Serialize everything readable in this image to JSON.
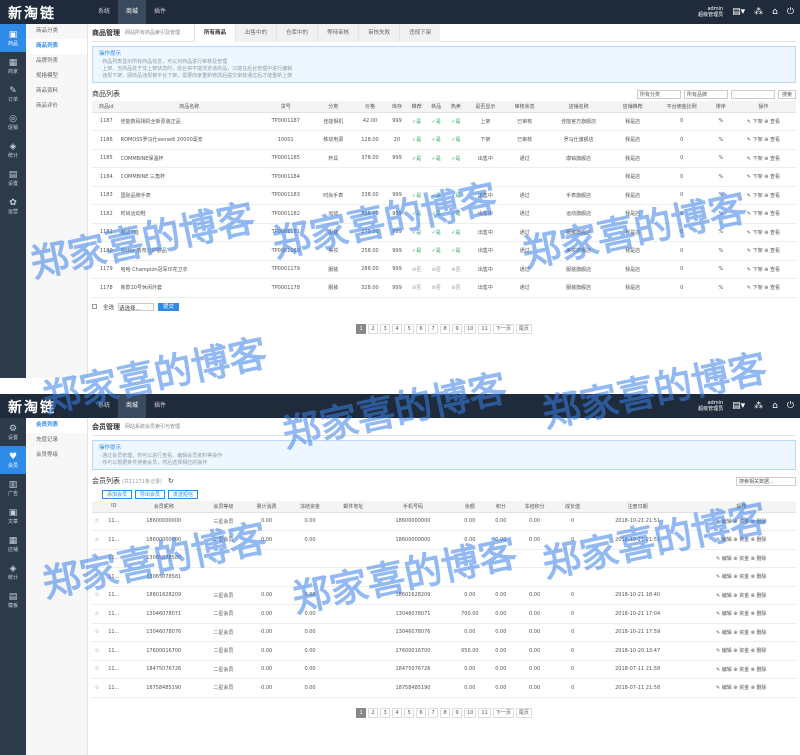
{
  "panel1": {
    "logo": "新淘链",
    "nav": [
      "系统",
      "商城",
      "插件"
    ],
    "nav_active": 1,
    "admin_name": "admin",
    "admin_role": "超级管理员",
    "sidebar": [
      {
        "icon": "▣",
        "label": "商品"
      },
      {
        "icon": "▦",
        "label": "商家"
      },
      {
        "icon": "✎",
        "label": "订单"
      },
      {
        "icon": "◎",
        "label": "促销"
      },
      {
        "icon": "◈",
        "label": "统计"
      },
      {
        "icon": "▤",
        "label": "设置"
      },
      {
        "icon": "✿",
        "label": "运营"
      }
    ],
    "sidebar_active": 0,
    "subnav": [
      "商品分类",
      "商品列表",
      "品牌列表",
      "规格模型",
      "商品资料",
      "商品评价"
    ],
    "subnav_active": 1,
    "title": "商品管理",
    "subtitle": "网站所有商品索引及管理",
    "tabs": [
      "所有商品",
      "出售中的",
      "仓库中的",
      "等待审核",
      "审核失败",
      "违规下架"
    ],
    "tab_active": 0,
    "tip_head": "操作提示",
    "tips": [
      "· 商品列表显示所有商品信息，可以对商品进行审核及管理",
      "· 上架，当商品处于非上架状态时，前台将不能浏览该商品，只能在后台管理中进行编辑",
      "· 违规下架，即商品违规被平台下架，需要商家重新修改后提交审核通过后才能重新上架"
    ],
    "list_title": "商品列表",
    "filter1": "所有分类",
    "filter2": "所有品牌",
    "search_btn": "搜索",
    "columns": [
      "商品id",
      "商品名称",
      "货号",
      "分类",
      "价格",
      "库存",
      "推荐",
      "新品",
      "热卖",
      "是否显示",
      "审核状态",
      "店铺名称",
      "店铺推荐",
      "平台佣金比例",
      "排序",
      "操作"
    ],
    "rows": [
      [
        "1187",
        "佳能数码相机全新原装正品",
        "TP0001187",
        "佳能相机",
        "42.00",
        "999",
        "✓是",
        "✓是",
        "✓是",
        "上架",
        "已审核",
        "佳能官方旗舰店",
        "我是店",
        "0",
        "%",
        "✎ 下架 ⊕ 查看"
      ],
      [
        "1186",
        "ROMOSS罗马仕sense6 20000毫安",
        "10001",
        "移动电源",
        "128.00",
        "20",
        "✓是",
        "✓是",
        "✓是",
        "下架",
        "已审核",
        "罗马仕旗舰店",
        "我是店",
        "0",
        "%",
        "✎ 下架 ⊕ 查看"
      ],
      [
        "1185",
        "COMMBINE保温杯",
        "TP0001185",
        "杯具",
        "378.00",
        "999",
        "✓是",
        "✓是",
        "✓是",
        "出售中",
        "通过",
        "康铂旗舰店",
        "我是店",
        "0",
        "%",
        "✎ 下架 ⊕ 查看"
      ],
      [
        "1184",
        "COMMBINE 三角杯",
        "TP0001184",
        "",
        "",
        "",
        "",
        "",
        "",
        "",
        "",
        "",
        "我是店",
        "0",
        "%",
        "✎ 下架 ⊕ 查看"
      ],
      [
        "1183",
        "国际品牌手表",
        "TP0001183",
        "时尚手表",
        "338.00",
        "999",
        "✓是",
        "✓是",
        "✓是",
        "出售中",
        "通过",
        "手表旗舰店",
        "我是店",
        "0",
        "%",
        "✎ 下架 ⊕ 查看"
      ],
      [
        "1182",
        "时尚运动鞋",
        "TP0001182",
        "运动",
        "338.00",
        "999",
        "✓是",
        "✓是",
        "✓是",
        "出售中",
        "通过",
        "运动旗舰店",
        "我是店",
        "0",
        "%",
        "✎ 下架 ⊕ 查看"
      ],
      [
        "1181",
        "潮流T恤",
        "TP0001181",
        "服装",
        "279.00",
        "999",
        "✓是",
        "✓是",
        "✓是",
        "出售中",
        "通过",
        "服装旗舰店",
        "我是店",
        "0",
        "%",
        "✎ 下架 ⊕ 查看"
      ],
      [
        "1180",
        "Sisley 香奈儿护肤品",
        "TP0001180",
        "美妆",
        "258.00",
        "999",
        "✓是",
        "✓是",
        "✓是",
        "出售中",
        "通过",
        "美妆旗舰店",
        "我是店",
        "0",
        "%",
        "✎ 下架 ⊕ 查看"
      ],
      [
        "1179",
        "哈哈 Champion冠军印花卫衣",
        "TP0001179",
        "服装",
        "288.00",
        "999",
        "⊘否",
        "⊘否",
        "⊘否",
        "出售中",
        "通过",
        "服装旗舰店",
        "我是店",
        "0",
        "%",
        "✎ 下架 ⊕ 查看"
      ],
      [
        "1178",
        "新款10号休闲外套",
        "TP0001178",
        "服装",
        "328.00",
        "999",
        "⊘否",
        "⊘否",
        "⊘否",
        "出售中",
        "通过",
        "服装旗舰店",
        "我是店",
        "0",
        "%",
        "✎ 下架 ⊕ 查看"
      ]
    ],
    "bulk_label": "全选",
    "bulk_select": "请选择...",
    "bulk_btn": "提交",
    "pages": [
      "1",
      "2",
      "3",
      "4",
      "5",
      "6",
      "7",
      "8",
      "9",
      "10",
      "11",
      "下一页",
      "尾页"
    ]
  },
  "panel2": {
    "logo": "新淘链",
    "nav": [
      "系统",
      "商城",
      "插件"
    ],
    "nav_active": 1,
    "admin_name": "admin",
    "admin_role": "超级管理员",
    "sidebar": [
      {
        "icon": "⚙",
        "label": "设置"
      },
      {
        "icon": "♥",
        "label": "会员"
      },
      {
        "icon": "▥",
        "label": "广告"
      },
      {
        "icon": "▣",
        "label": "文章"
      },
      {
        "icon": "▦",
        "label": "店铺"
      },
      {
        "icon": "◈",
        "label": "统计"
      },
      {
        "icon": "▤",
        "label": "模板"
      }
    ],
    "sidebar_active": 1,
    "subnav": [
      "会员列表",
      "充值记录",
      "会员等级"
    ],
    "subnav_active": 0,
    "title": "会员管理",
    "subtitle": "网站系统会员索引与管理",
    "tip_head": "操作提示",
    "tips": [
      "· 通过会员管理，你可以进行查看、编辑会员资料等操作",
      "· 你可以根据条件搜索会员，然后选择相应的操作"
    ],
    "list_title": "会员列表",
    "list_count": "(共11171条记录)",
    "refresh": "↻",
    "search_placeholder": "搜索相关数据...",
    "action_buttons": [
      "添加会员",
      "导出会员",
      "发送短信"
    ],
    "columns": [
      "",
      "ID",
      "会员昵称",
      "会员等级",
      "累计消费",
      "冻结资金",
      "邮件地址",
      "手机号码",
      "余额",
      "积分",
      "冻结积分",
      "成长值",
      "注册日期",
      "操作"
    ],
    "rows": [
      [
        "☆",
        "11...",
        "18600000000",
        "三星会员",
        "0.00",
        "0.00",
        "",
        "18600000000",
        "0.00",
        "0.00",
        "0.00",
        "0",
        "2018-10-21 21:51",
        "✎ 编辑 ⊕ 资金 ⊗ 删除"
      ],
      [
        "☆",
        "11...",
        "18600000000",
        "二星会员",
        "0.00",
        "0.00",
        "",
        "18600000000",
        "0.00",
        "0.00",
        "0.00",
        "0",
        "2018-10-21 21:51",
        "✎ 编辑 ⊕ 资金 ⊗ 删除"
      ],
      [
        "☆",
        "11...",
        "13065078580",
        "",
        "",
        "",
        "",
        "",
        "",
        "",
        "",
        "",
        "",
        "✎ 编辑 ⊕ 资金 ⊗ 删除"
      ],
      [
        "☆",
        "11...",
        "13065078581",
        "",
        "",
        "",
        "",
        "",
        "",
        "",
        "",
        "",
        "",
        "✎ 编辑 ⊕ 资金 ⊗ 删除"
      ],
      [
        "☆",
        "11...",
        "18601628209",
        "三星会员",
        "0.00",
        "0.00",
        "",
        "18601628209",
        "0.00",
        "0.00",
        "0.00",
        "0",
        "2018-10-21 18:40",
        "✎ 编辑 ⊕ 资金 ⊗ 删除"
      ],
      [
        "☆",
        "11...",
        "13046078071",
        "二星会员",
        "0.00",
        "0.00",
        "",
        "13046078071",
        "700.00",
        "0.00",
        "0.00",
        "0",
        "2018-10-21 17:04",
        "✎ 编辑 ⊕ 资金 ⊗ 删除"
      ],
      [
        "☆",
        "11...",
        "13046078076",
        "二星会员",
        "0.00",
        "0.00",
        "",
        "13046078076",
        "0.00",
        "0.00",
        "0.00",
        "0",
        "2018-10-21 17:59",
        "✎ 编辑 ⊕ 资金 ⊗ 删除"
      ],
      [
        "☆",
        "11...",
        "17600016700",
        "二星会员",
        "0.00",
        "0.00",
        "",
        "17600016700",
        "650.00",
        "0.00",
        "0.00",
        "0",
        "2018-10-20 13:47",
        "✎ 编辑 ⊕ 资金 ⊗ 删除"
      ],
      [
        "☆",
        "11...",
        "18475076726",
        "二星会员",
        "0.00",
        "0.00",
        "",
        "18475076726",
        "0.00",
        "0.00",
        "0.00",
        "0",
        "2018-07-11 21:58",
        "✎ 编辑 ⊕ 资金 ⊗ 删除"
      ],
      [
        "☆",
        "11...",
        "18758485190",
        "二星会员",
        "0.00",
        "0.00",
        "",
        "18758485190",
        "0.00",
        "0.00",
        "0.00",
        "0",
        "2018-07-11 21:58",
        "✎ 编辑 ⊕ 资金 ⊗ 删除"
      ]
    ],
    "pages": [
      "1",
      "2",
      "3",
      "4",
      "5",
      "6",
      "7",
      "8",
      "9",
      "10",
      "11",
      "下一页",
      "尾页"
    ]
  },
  "watermark": "郑家喜的博客",
  "colors": {
    "topbar": "#1f2b3a",
    "sidebar": "#2d3a4a",
    "accent": "#2f8be8",
    "watermark": "#3a80e8"
  }
}
